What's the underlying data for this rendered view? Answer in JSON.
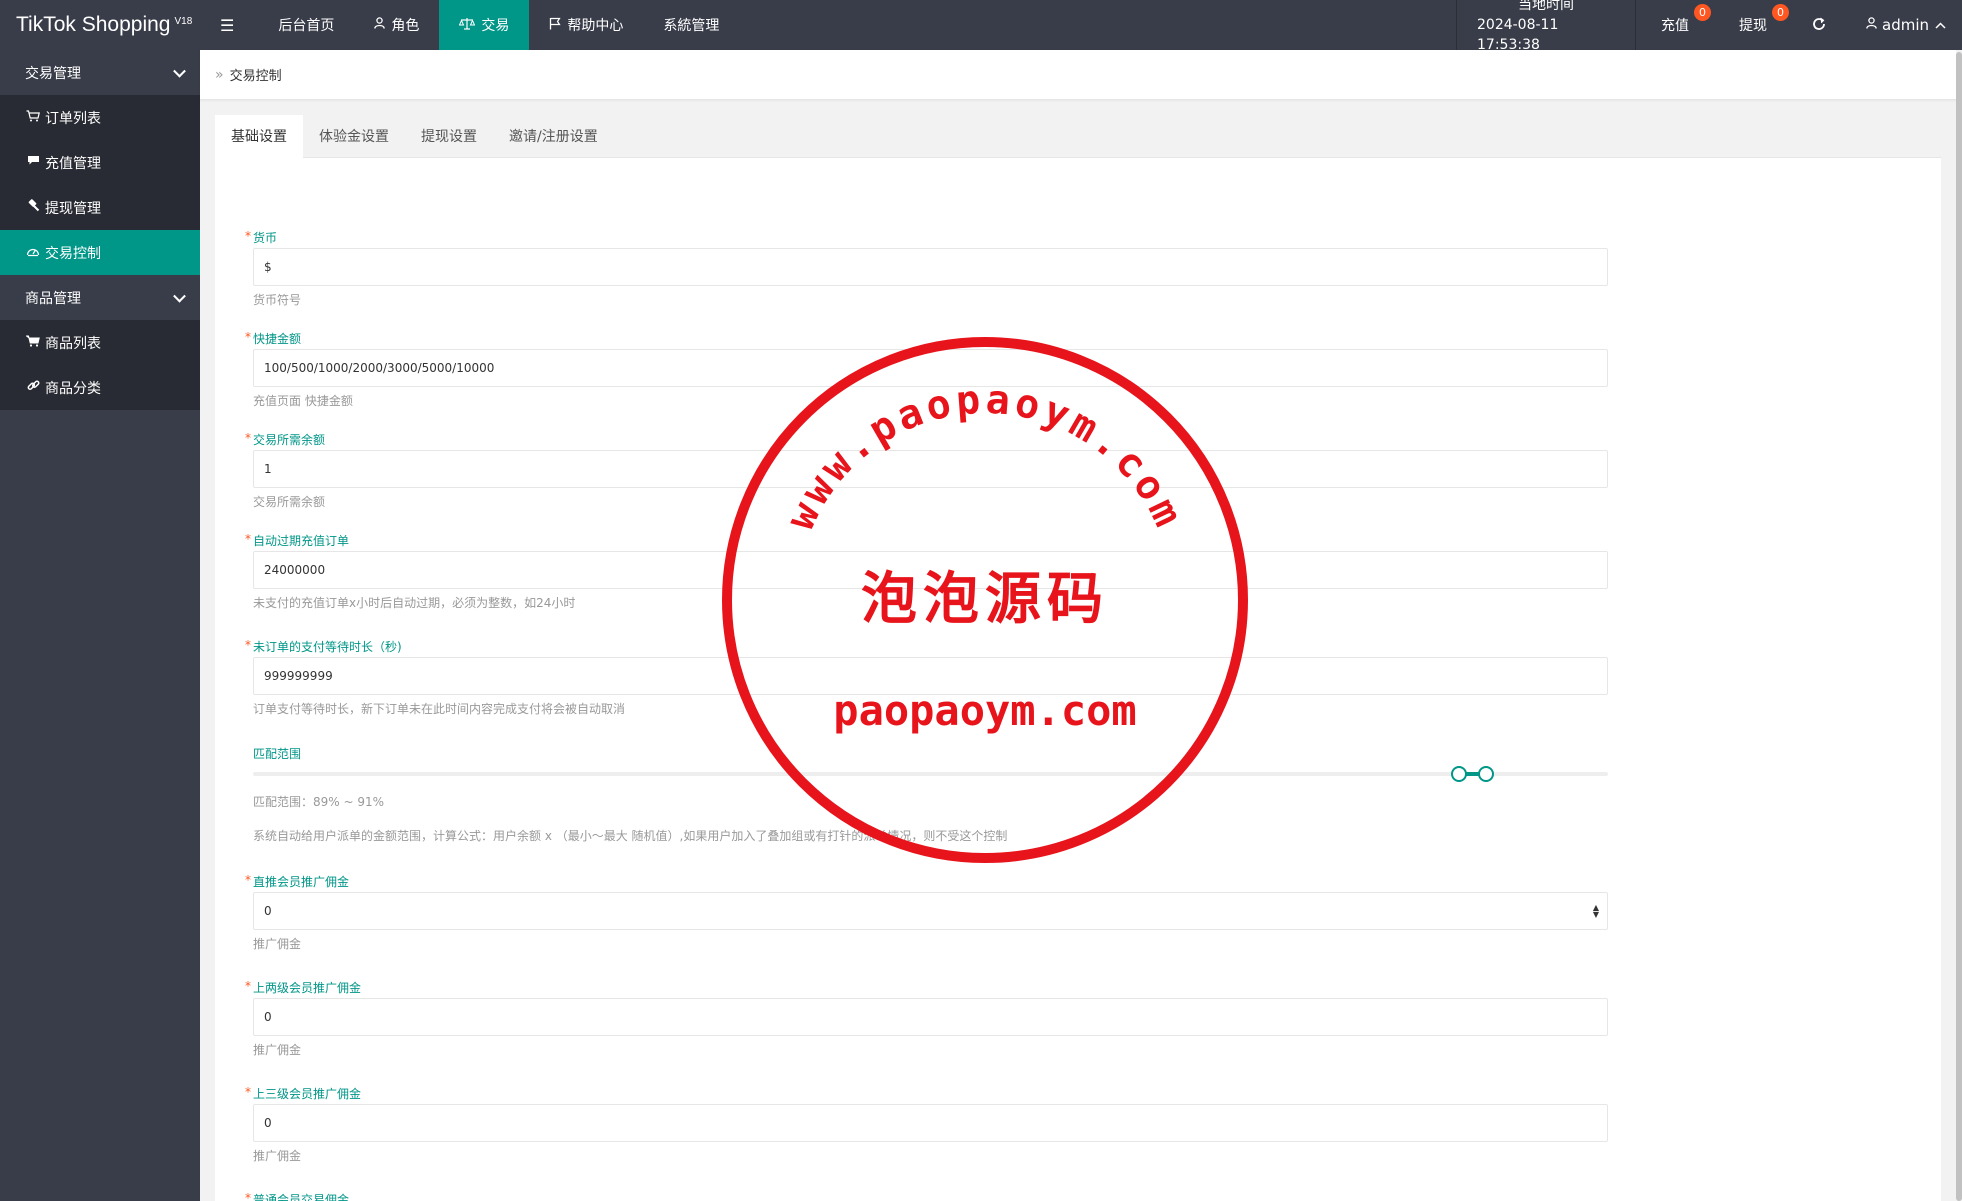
{
  "app": {
    "title": "TikTok Shopping",
    "version": "V18"
  },
  "topnav": {
    "items": [
      {
        "label": "后台首页",
        "icon": "home-icon"
      },
      {
        "label": "角色",
        "icon": "user-icon"
      },
      {
        "label": "交易",
        "icon": "scale-icon"
      },
      {
        "label": "帮助中心",
        "icon": "flag-icon"
      },
      {
        "label": "系統管理",
        "icon": ""
      }
    ],
    "active": "交易",
    "time_label": "当地时间",
    "time_value": "2024-08-11 17:53:38",
    "recharge_label": "充值",
    "recharge_count": "0",
    "withdraw_label": "提现",
    "withdraw_count": "0",
    "user": "admin"
  },
  "sidebar": {
    "groups": [
      {
        "label": "交易管理",
        "items": [
          {
            "label": "订单列表",
            "icon": "cart-icon"
          },
          {
            "label": "充值管理",
            "icon": "chat-icon"
          },
          {
            "label": "提现管理",
            "icon": "gavel-icon"
          },
          {
            "label": "交易控制",
            "icon": "dashboard-icon",
            "active": true
          }
        ]
      },
      {
        "label": "商品管理",
        "items": [
          {
            "label": "商品列表",
            "icon": "cart-filled-icon"
          },
          {
            "label": "商品分类",
            "icon": "link-icon"
          }
        ]
      }
    ]
  },
  "breadcrumb": {
    "current": "交易控制"
  },
  "tabs": [
    "基础设置",
    "体验金设置",
    "提现设置",
    "邀请/注册设置"
  ],
  "active_tab": "基础设置",
  "form": {
    "currency": {
      "label": "货币",
      "value": "$",
      "help": "货币符号"
    },
    "quick_amount": {
      "label": "快捷金额",
      "value": "100/500/1000/2000/3000/5000/10000",
      "help": "充值页面 快捷金额"
    },
    "trade_balance": {
      "label": "交易所需余额",
      "value": "1",
      "help": "交易所需余额"
    },
    "auto_expire": {
      "label": "自动过期充值订单",
      "value": "24000000",
      "help": "未支付的充值订单x小时后自动过期，必须为整数，如24小时"
    },
    "pay_wait": {
      "label": "未订单的支付等待时长（秒)",
      "value": "999999999",
      "help": "订单支付等待时长，新下订单未在此时间内容完成支付将会被自动取消"
    },
    "match_range": {
      "label": "匹配范围",
      "range_text": "匹配范围：89% ~ 91%",
      "min_percent": 89,
      "max_percent": 91,
      "help": "系统自动给用户派单的金额范围，计算公式：用户余额 x （最小～最大 随机值）,如果用户加入了叠加组或有打针的派单情况，则不受这个控制"
    },
    "direct_commission": {
      "label": "直推会员推广佣金",
      "value": "0",
      "help": "推广佣金"
    },
    "level2_commission": {
      "label": "上两级会员推广佣金",
      "value": "0",
      "help": "推广佣金"
    },
    "level3_commission": {
      "label": "上三级会员推广佣金",
      "value": "0",
      "help": "推广佣金"
    },
    "normal_commission": {
      "label": "普通会员交易佣金"
    }
  },
  "watermark": {
    "top_arc": "www.paopaoym.com",
    "center": "泡泡源码",
    "bottom": "paopaoym.com"
  },
  "colors": {
    "primary": "#009688",
    "dark": "#393d49",
    "badge": "#ff5722",
    "stamp": "#e8141b"
  }
}
